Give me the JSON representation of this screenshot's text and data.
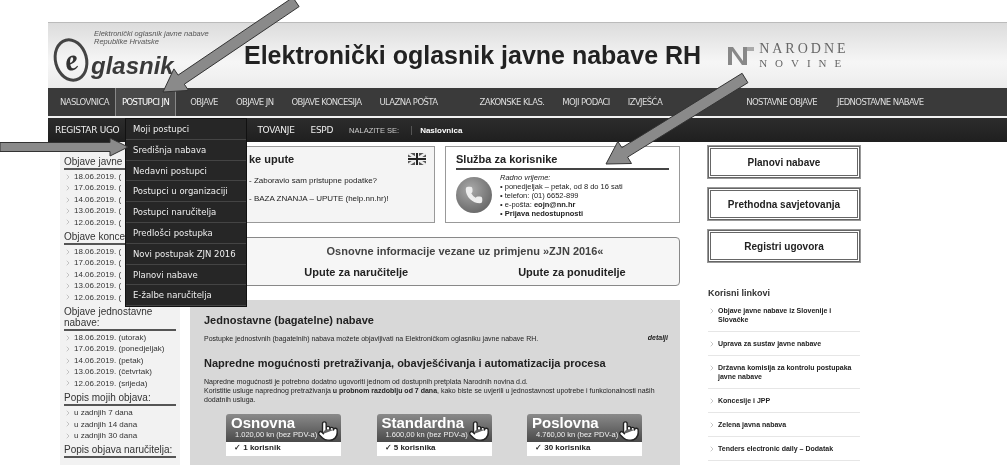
{
  "header": {
    "logo_letter": "e",
    "logo_text": "glasnik",
    "logo_tagline": "Elektronički oglasnik javne nabave Republike Hrvatske",
    "title": "Elektronički oglasnik javne nabave RH",
    "publisher_top": "NARODNE",
    "publisher_bottom": "NOVINE"
  },
  "main_nav": [
    {
      "label": "NASLOVNICA",
      "selected": false
    },
    {
      "label": "POSTUPCI JN",
      "selected": true
    },
    {
      "label": "OBJAVE",
      "selected": false
    },
    {
      "label": "OBJAVE JN",
      "selected": false
    },
    {
      "label": "OBJAVE KONCESIJA",
      "selected": false
    },
    {
      "label": "ULAZNA POŠTA",
      "selected": false
    },
    {
      "label": "ZAKONSKE KLAS.",
      "selected": false
    },
    {
      "label": "MOJI PODACI",
      "selected": false
    },
    {
      "label": "IZVJEŠĆA",
      "selected": false
    },
    {
      "label": "NOSTAVNE OBJAVE",
      "selected": false
    },
    {
      "label": "JEDNOSTAVNE NABAVE",
      "selected": false
    }
  ],
  "sub_nav": {
    "first_item": "REGISTAR UGO",
    "items": [
      "TOVANJE",
      "ESPD"
    ],
    "location_label": "NALAZITE SE:",
    "location": "Naslovnica"
  },
  "dropdown": [
    "Moji postupci",
    "Središnja nabava",
    "Nedavni postupci",
    "Postupci u organizaciji",
    "Postupci naručitelja",
    "Predlošci postupka",
    "Novi postupak ZJN 2016",
    "Planovi nabave",
    "E-žalbe naručitelja"
  ],
  "sidebar": [
    {
      "title": "Objave javne",
      "items": [
        "18.06.2019. (",
        "17.06.2019. (",
        "14.06.2019. (",
        "13.06.2019. (",
        "12.06.2019. ("
      ]
    },
    {
      "title": "Objave konce",
      "items": [
        "18.06.2019. (",
        "17.06.2019. (",
        "14.06.2019. (",
        "13.06.2019. (",
        "12.06.2019. ("
      ]
    },
    {
      "title": "Objave jednostavne nabave:",
      "items": [
        "18.06.2019. (utorak)",
        "17.06.2019. (ponedjeljak)",
        "14.06.2019. (petak)",
        "13.06.2019. (četvrtak)",
        "12.06.2019. (srijeda)"
      ]
    },
    {
      "title": "Popis mojih objava:",
      "items": [
        "u zadnjih 7 dana",
        "u zadnjih 14 dana",
        "u zadnjih 30 dana"
      ]
    },
    {
      "title": "Popis objava naručitelja:"
    }
  ],
  "help_box": {
    "title": "ke upute",
    "links": [
      "- Zaboravio sam pristupne podatke?",
      "- BAZA ZNANJA – UPUTE (help.nn.hr)!"
    ]
  },
  "support_box": {
    "title": "Služba za korisnike",
    "hours_label": "Radno vrijeme:",
    "lines": [
      "• ponedjeljak – petak, od 8 do 16 sati",
      "• telefon: (01) 6652-899",
      "• e-pošta: **eojn@nn.hr**",
      "• **Prijava nedostupnosti**"
    ]
  },
  "info_box": {
    "title": "Osnovne informacije vezane uz primjenu »ZJN 2016«",
    "links": [
      "Upute za naručitelje",
      "Upute za ponuditelje"
    ]
  },
  "promo": {
    "title": "Jednostavne (bagatelne) nabave",
    "text": "Postupke jednostvnih (bagatelnih) nabava možete objavljivati na Elektroničkom oglasniku javne nabave RH.",
    "details": "detalji",
    "title_2": "Napredne mogućnosti pretraživanja, obavješćivanja i automatizacija procesa",
    "text_2": [
      "Napredne mogućnosti je potrebno dodatno ugovoriti jednom od dostupnih pretplata Narodnih novina d.d.",
      "Koristitie usluge naprednog pretraživanja **u probnom razdoblju od 7 dana**, kako biste se uvjerili u jednostavnost upotrebe i funkcionalnosti naših dodatnih usluga."
    ],
    "plans": [
      {
        "name": "Osnovna",
        "price": "1.020,00 kn (bez PDV-a)",
        "feature": "✓ 1 korisnik"
      },
      {
        "name": "Standardna",
        "price": "1.600,00 kn (bez PDV-a)",
        "feature": "✓ 5 korisnika"
      },
      {
        "name": "Poslovna",
        "price": "4.760,00 kn (bez PDV-a)",
        "feature": "✓ 30 korisnika"
      }
    ]
  },
  "quick_buttons": [
    "Planovi nabave",
    "Prethodna savjetovanja",
    "Registri ugovora"
  ],
  "useful_links": {
    "title": "Korisni linkovi",
    "items": [
      "Objave javne nabave iz Slovenije i Slovačke",
      "Uprava za sustav javne nabave",
      "Državna komisija za kontrolu postupaka javne nabave",
      "Koncesije i JPP",
      "Zelena javna nabava",
      "Tenders electronic daily – Dodatak"
    ]
  }
}
